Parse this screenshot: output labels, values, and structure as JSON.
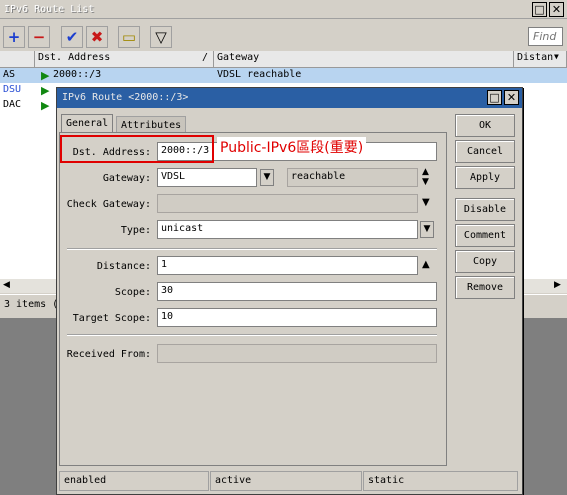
{
  "list_window": {
    "title": "IPv6 Route List",
    "title_buttons": [
      "□",
      "✕"
    ],
    "toolbar": {
      "add": "+",
      "remove": "−",
      "enable": "✔",
      "disable": "✖",
      "comment": "▭",
      "filter": "▽",
      "find_placeholder": "Find"
    },
    "columns": [
      "",
      "Dst. Address",
      "Gateway",
      "Distan"
    ],
    "sort_indicator": "/",
    "rows": [
      {
        "flags": "AS",
        "dst": "2000::/3",
        "gateway": "VDSL reachable"
      },
      {
        "flags": "DSU",
        "dst": "",
        "gateway": ""
      },
      {
        "flags": "DAC",
        "dst": "",
        "gateway": ""
      }
    ],
    "status": "3 items ("
  },
  "dialog": {
    "title": "IPv6 Route <2000::/3>",
    "title_buttons": [
      "□",
      "✕"
    ],
    "tabs": [
      "General",
      "Attributes"
    ],
    "fields": {
      "dst_address": {
        "label": "Dst. Address:",
        "value": "2000::/3"
      },
      "gateway": {
        "label": "Gateway:",
        "value": "VDSL",
        "state": "reachable"
      },
      "check_gateway": {
        "label": "Check Gateway:",
        "value": ""
      },
      "type": {
        "label": "Type:",
        "value": "unicast"
      },
      "distance": {
        "label": "Distance:",
        "value": "1"
      },
      "scope": {
        "label": "Scope:",
        "value": "30"
      },
      "target_scope": {
        "label": "Target Scope:",
        "value": "10"
      },
      "received_from": {
        "label": "Received From:",
        "value": ""
      }
    },
    "buttons": [
      "OK",
      "Cancel",
      "Apply",
      "Disable",
      "Comment",
      "Copy",
      "Remove"
    ],
    "status": [
      "enabled",
      "active",
      "static"
    ]
  },
  "annotation": {
    "text": "Public-IPv6區段(重要)",
    "color": "#e00000"
  }
}
